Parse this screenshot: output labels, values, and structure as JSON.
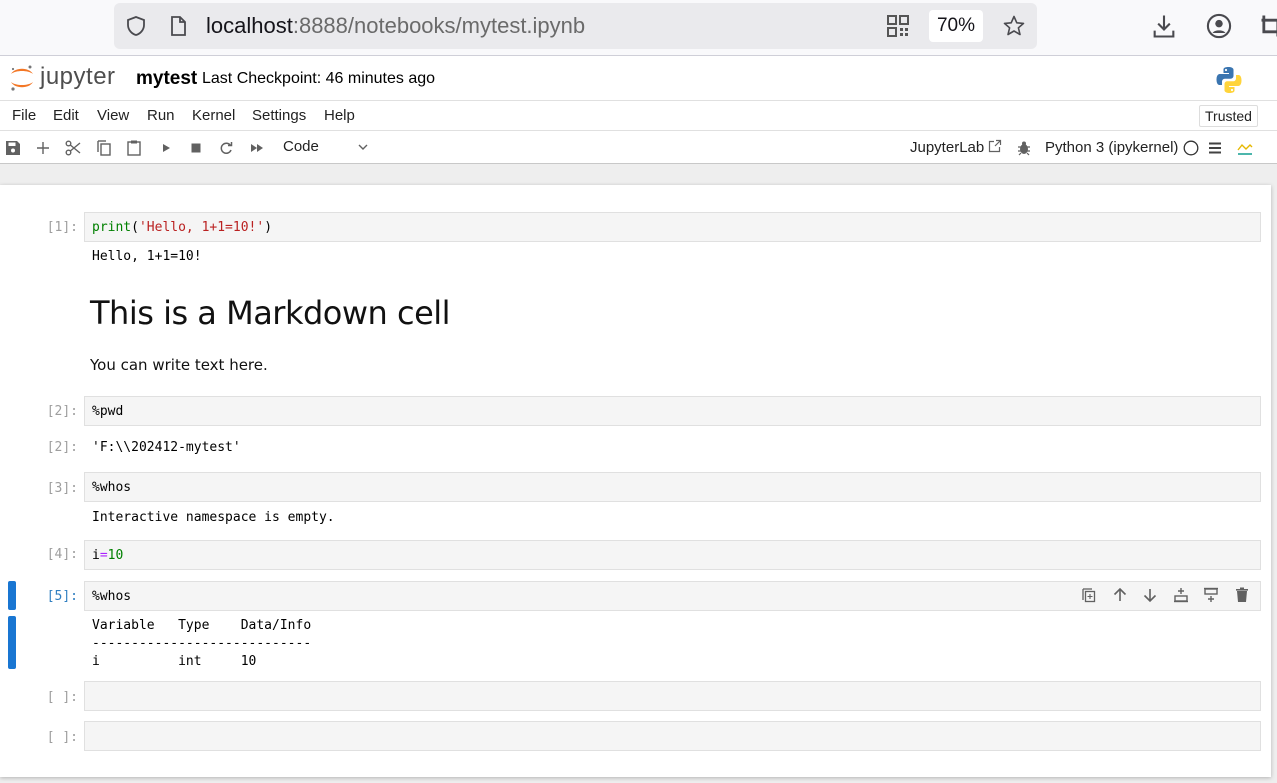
{
  "browser": {
    "url_host": "localhost",
    "url_rest": ":8888/notebooks/mytest.ipynb",
    "zoom_level": "70%",
    "icons": [
      "shield-icon",
      "page-icon",
      "qr-code-icon",
      "bookmark-star-icon",
      "download-icon",
      "account-icon",
      "extension-icon"
    ]
  },
  "header": {
    "logo_text": "jupyter",
    "notebook_title": "mytest",
    "checkpoint": "Last Checkpoint: 46 minutes ago"
  },
  "menu": {
    "items": [
      "File",
      "Edit",
      "View",
      "Run",
      "Kernel",
      "Settings",
      "Help"
    ],
    "trusted": "Trusted"
  },
  "toolbar": {
    "buttons": [
      "save",
      "insert-cell",
      "cut",
      "copy",
      "paste",
      "run",
      "interrupt",
      "restart",
      "restart-run-all"
    ],
    "cell_type": "Code",
    "jupyterlab_link": "JupyterLab",
    "kernel_name": "Python 3 (ipykernel)"
  },
  "colors": {
    "accent": "#1976d2",
    "prompt_active": "#307fc1",
    "prompt_inactive": "#9e9e9e",
    "code_bg": "#f5f5f5"
  },
  "cells": {
    "c1": {
      "prompt": "[1]:",
      "code_builtin": "print",
      "code_open": "(",
      "code_string": "'Hello, 1+1=10!'",
      "code_close": ")",
      "output": "Hello, 1+1=10!"
    },
    "md": {
      "heading": "This is a Markdown cell",
      "paragraph": "You can write text here."
    },
    "c2": {
      "prompt": "[2]:",
      "code": "%pwd",
      "out_prompt": "[2]:",
      "output": "'F:\\\\202412-mytest'"
    },
    "c3": {
      "prompt": "[3]:",
      "code": "%whos",
      "output": "Interactive namespace is empty."
    },
    "c4": {
      "prompt": "[4]:",
      "code_var": "i",
      "code_op": "=",
      "code_num": "10"
    },
    "c5": {
      "prompt": "[5]:",
      "code": "%whos",
      "output_header": "Variable   Type    Data/Info",
      "output_rule": "----------------------------",
      "output_row": "i          int     10"
    },
    "c6": {
      "prompt": "[ ]:"
    },
    "c7": {
      "prompt": "[ ]:"
    }
  },
  "cell_toolbar": [
    "duplicate",
    "move-up",
    "move-down",
    "insert-above",
    "insert-below",
    "delete"
  ]
}
